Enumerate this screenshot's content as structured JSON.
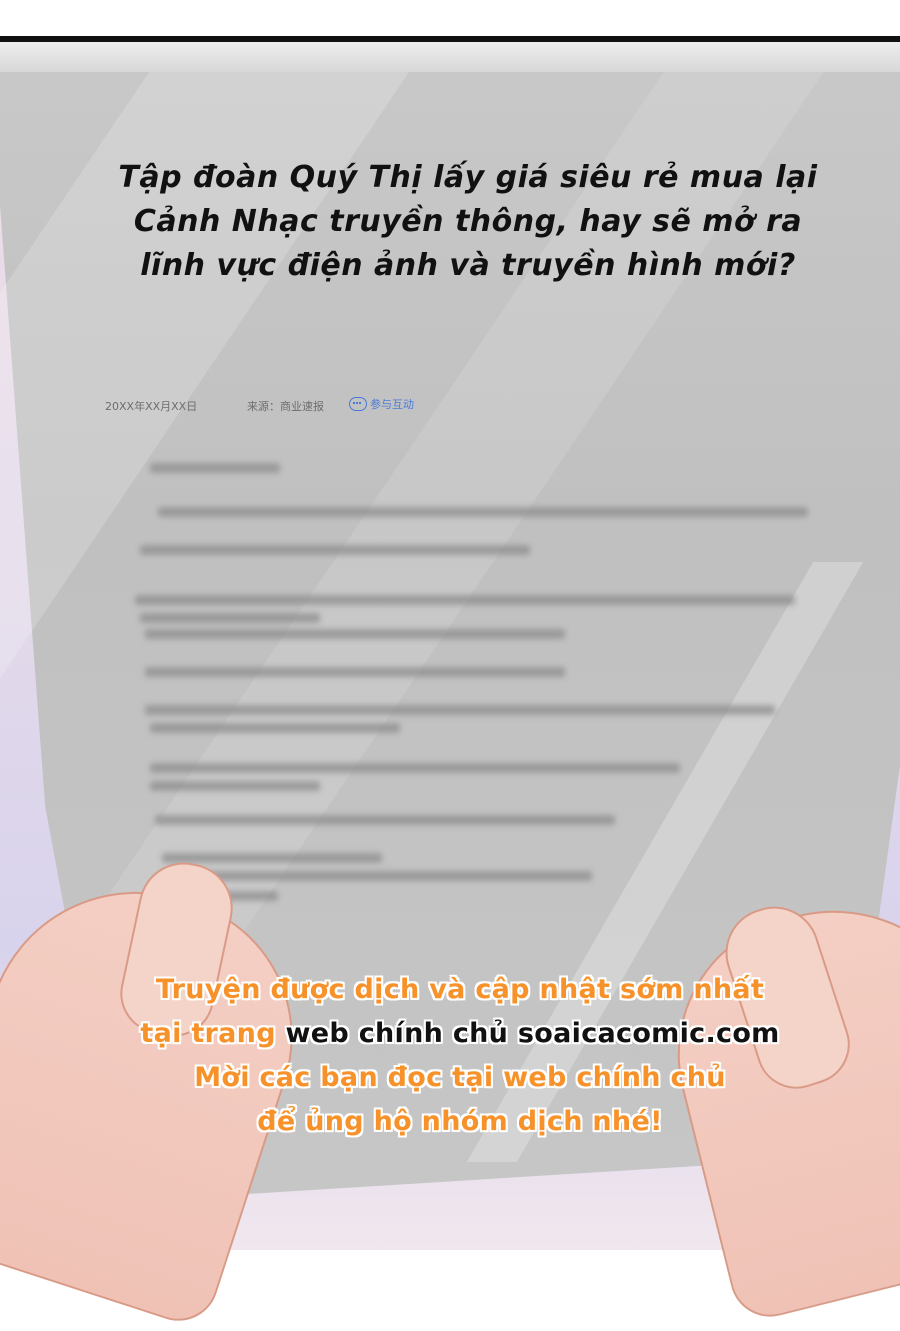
{
  "headline": {
    "line1": "Tập đoàn Quý Thị lấy giá siêu rẻ mua lại",
    "line2": "Cảnh Nhạc truyền thông, hay sẽ mở ra",
    "line3": "lĩnh vực điện ảnh và truyền hình mới?"
  },
  "article_meta": {
    "date": "20XX年XX月XX日",
    "source": "来源：商业速报",
    "share": "参与互动",
    "share_icon": "chat-bubble-icon"
  },
  "promo": {
    "line1": "Truyện được dịch và cập nhật sớm nhất",
    "line2_prefix": "tại trang",
    "line2_highlight": "web chính chủ soaicacomic.com",
    "line3": "Mời các bạn đọc tại web chính chủ",
    "line4": "để ủng hộ nhóm dịch nhé!",
    "orange_color": "#f7922a",
    "dark_color": "#111111"
  }
}
